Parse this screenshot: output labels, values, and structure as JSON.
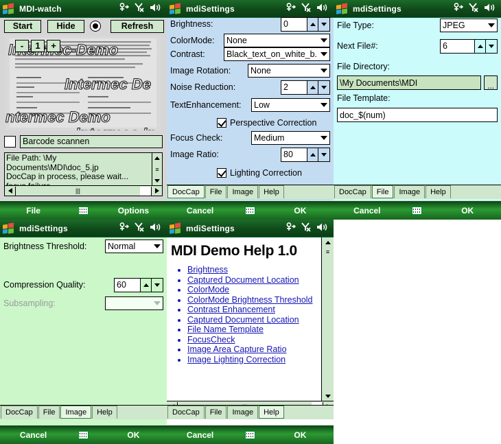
{
  "panels": {
    "watch": {
      "title": "MDI-watch",
      "buttons": {
        "start": "Start",
        "hide": "Hide",
        "refresh": "Refresh"
      },
      "zoom": {
        "minus": "-",
        "level": "1",
        "plus": "+"
      },
      "barcode_label": "Barcode scannen",
      "log_lines": [
        "File Path: \\My Documents\\MDI\\doc_5.jp",
        "DocCap in process, please wait...",
        "focus failure"
      ],
      "softkeys": {
        "left": "File",
        "right": "Options"
      }
    },
    "settings_doccap": {
      "title": "mdiSettings",
      "fields": [
        {
          "label": "Brightness:",
          "value": "0",
          "kind": "spinner"
        },
        {
          "label": "ColorMode:",
          "value": "None",
          "kind": "dropdown"
        },
        {
          "label": "Contrast:",
          "value": "Black_text_on_white_b.",
          "kind": "dropdown"
        },
        {
          "label": "Image Rotation:",
          "value": "None",
          "kind": "dropdown"
        },
        {
          "label": "Noise Reduction:",
          "value": "2",
          "kind": "spinner"
        },
        {
          "label": "TextEnhancement:",
          "value": "Low",
          "kind": "dropdown"
        },
        {
          "label": "Perspective Correction",
          "value": "checked",
          "kind": "checkbox"
        },
        {
          "label": "Focus Check:",
          "value": "Medium",
          "kind": "dropdown"
        },
        {
          "label": "Image Ratio:",
          "value": "80",
          "kind": "spinner"
        },
        {
          "label": "Lighting Correction",
          "value": "checked",
          "kind": "checkbox"
        }
      ],
      "tabs": [
        "DocCap",
        "File",
        "Image",
        "Help"
      ],
      "selected_tab": "DocCap",
      "softkeys": {
        "left": "Cancel",
        "right": "OK"
      }
    },
    "settings_file": {
      "title": "mdiSettings",
      "file_type_label": "File Type:",
      "file_type_value": "JPEG",
      "next_file_label": "Next File#:",
      "next_file_value": "6",
      "file_dir_label": "File Directory:",
      "file_dir_value": "\\My Documents\\MDI",
      "browse_label": "...",
      "file_template_label": "File Template:",
      "file_template_value": "doc_$(num)",
      "tabs": [
        "DocCap",
        "File",
        "Image",
        "Help"
      ],
      "selected_tab": "File",
      "softkeys": {
        "left": "Cancel",
        "right": "OK"
      }
    },
    "settings_image": {
      "title": "mdiSettings",
      "fields": [
        {
          "label": "Brightness Threshold:",
          "value": "Normal",
          "kind": "dropdown",
          "disabled": false
        },
        {
          "label": "Compression Quality:",
          "value": "60",
          "kind": "spinner",
          "disabled": false
        },
        {
          "label": "Subsampling:",
          "value": "",
          "kind": "dropdown",
          "disabled": true
        }
      ],
      "tabs": [
        "DocCap",
        "File",
        "Image",
        "Help"
      ],
      "selected_tab": "Image",
      "softkeys": {
        "left": "Cancel",
        "right": "OK"
      }
    },
    "settings_help": {
      "title": "mdiSettings",
      "heading": "MDI Demo Help 1.0",
      "links": [
        "Brightness",
        "Captured Document Location",
        "ColorMode",
        "ColorMode Brightness Threshold",
        "Contrast Enhancement",
        "Captured Document Location",
        "File Name Template",
        "FocusCheck",
        "Image Area Capture Ratio",
        "Image Lighting Correction"
      ],
      "tabs": [
        "DocCap",
        "File",
        "Image",
        "Help"
      ],
      "selected_tab": "Help",
      "softkeys": {
        "left": "Cancel",
        "right": "OK"
      }
    }
  },
  "statusbar_icons": [
    "connectivity-icon",
    "signal-off-icon",
    "speaker-icon"
  ],
  "colors": {
    "titlebar": "#0f4a1a",
    "softkey": "#2d9a32",
    "panel_doccap_bg": "#c4dcf2",
    "panel_file_bg": "#cbfbfb",
    "panel_image_bg": "#cbf7c9",
    "button_face": "#cfe7cc",
    "link": "#1414b4"
  },
  "preview": {
    "overlay_texts": [
      "Intermec-Demo",
      "Intermec De",
      "ntermec Demo",
      "Intermec In"
    ]
  }
}
